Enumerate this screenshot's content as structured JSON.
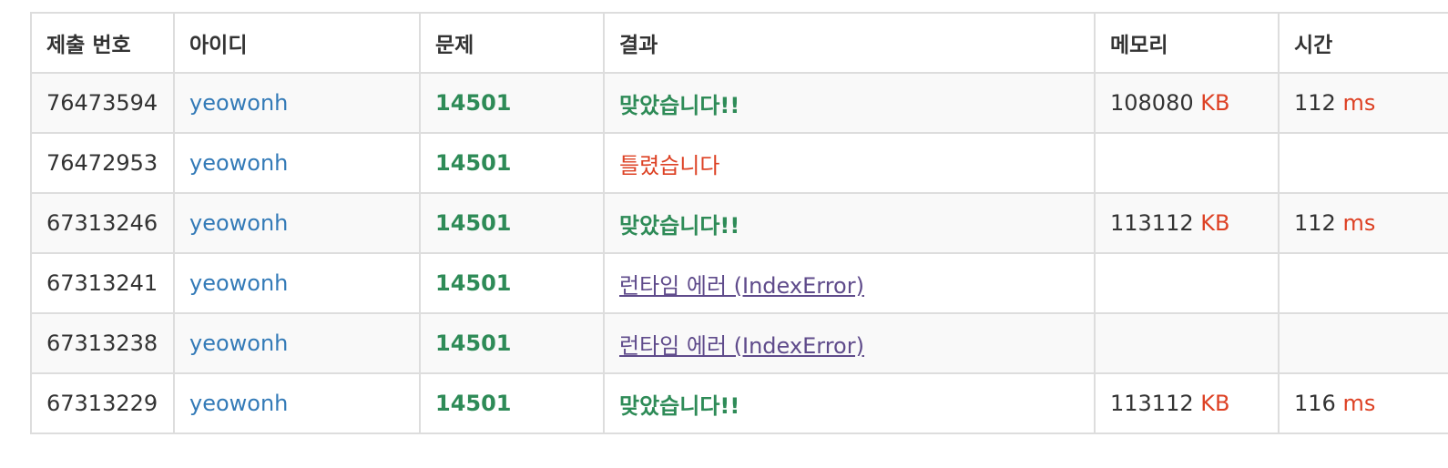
{
  "headers": [
    "제출 번호",
    "아이디",
    "문제",
    "결과",
    "메모리",
    "시간"
  ],
  "rows": [
    {
      "id": "76473594",
      "user": "yeowonh",
      "problem": "14501",
      "result": "맞았습니다!!",
      "result_type": "ac",
      "memory": "108080",
      "memory_unit": "KB",
      "time": "112",
      "time_unit": "ms"
    },
    {
      "id": "76472953",
      "user": "yeowonh",
      "problem": "14501",
      "result": "틀렸습니다",
      "result_type": "wa",
      "memory": "",
      "memory_unit": "",
      "time": "",
      "time_unit": ""
    },
    {
      "id": "67313246",
      "user": "yeowonh",
      "problem": "14501",
      "result": "맞았습니다!!",
      "result_type": "ac",
      "memory": "113112",
      "memory_unit": "KB",
      "time": "112",
      "time_unit": "ms"
    },
    {
      "id": "67313241",
      "user": "yeowonh",
      "problem": "14501",
      "result": "런타임 에러 (IndexError)",
      "result_type": "rte",
      "memory": "",
      "memory_unit": "",
      "time": "",
      "time_unit": ""
    },
    {
      "id": "67313238",
      "user": "yeowonh",
      "problem": "14501",
      "result": "런타임 에러 (IndexError)",
      "result_type": "rte",
      "memory": "",
      "memory_unit": "",
      "time": "",
      "time_unit": ""
    },
    {
      "id": "67313229",
      "user": "yeowonh",
      "problem": "14501",
      "result": "맞았습니다!!",
      "result_type": "ac",
      "memory": "113112",
      "memory_unit": "KB",
      "time": "116",
      "time_unit": "ms"
    }
  ],
  "colors": {
    "accepted": "#2e8b57",
    "wrong": "#dd4124",
    "runtime_error": "#5f4b8b",
    "user_link": "#337ab7",
    "unit": "#dd4124"
  }
}
